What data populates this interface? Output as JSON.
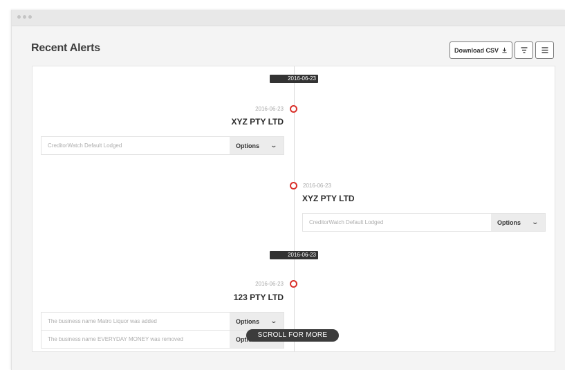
{
  "header": {
    "title": "Recent Alerts",
    "download_label": "Download CSV",
    "download_icon": "download-icon",
    "filter_icon": "filter-icon",
    "list_icon": "list-icon"
  },
  "timeline": {
    "groups": [
      {
        "date": "2016-06-23",
        "entries": [
          {
            "date": "2016-06-23",
            "company": "XYZ PTY LTD",
            "side": "left",
            "alerts": [
              {
                "text": "CreditorWatch Default Lodged",
                "options_label": "Options"
              }
            ]
          },
          {
            "date": "2016-06-23",
            "company": "XYZ PTY LTD",
            "side": "right",
            "alerts": [
              {
                "text": "CreditorWatch Default Lodged",
                "options_label": "Options"
              }
            ]
          }
        ]
      },
      {
        "date": "2016-06-23",
        "entries": [
          {
            "date": "2016-06-23",
            "company": "123 PTY LTD",
            "side": "left",
            "alerts": [
              {
                "text": "The business name Matro Liquor was added",
                "options_label": "Options"
              },
              {
                "text": "The business name EVERYDAY MONEY was removed",
                "options_label": "Options"
              }
            ]
          }
        ]
      }
    ]
  },
  "scroll_hint": "SCROLL FOR MORE",
  "colors": {
    "marker": "#d9302a",
    "badge": "#333333"
  }
}
